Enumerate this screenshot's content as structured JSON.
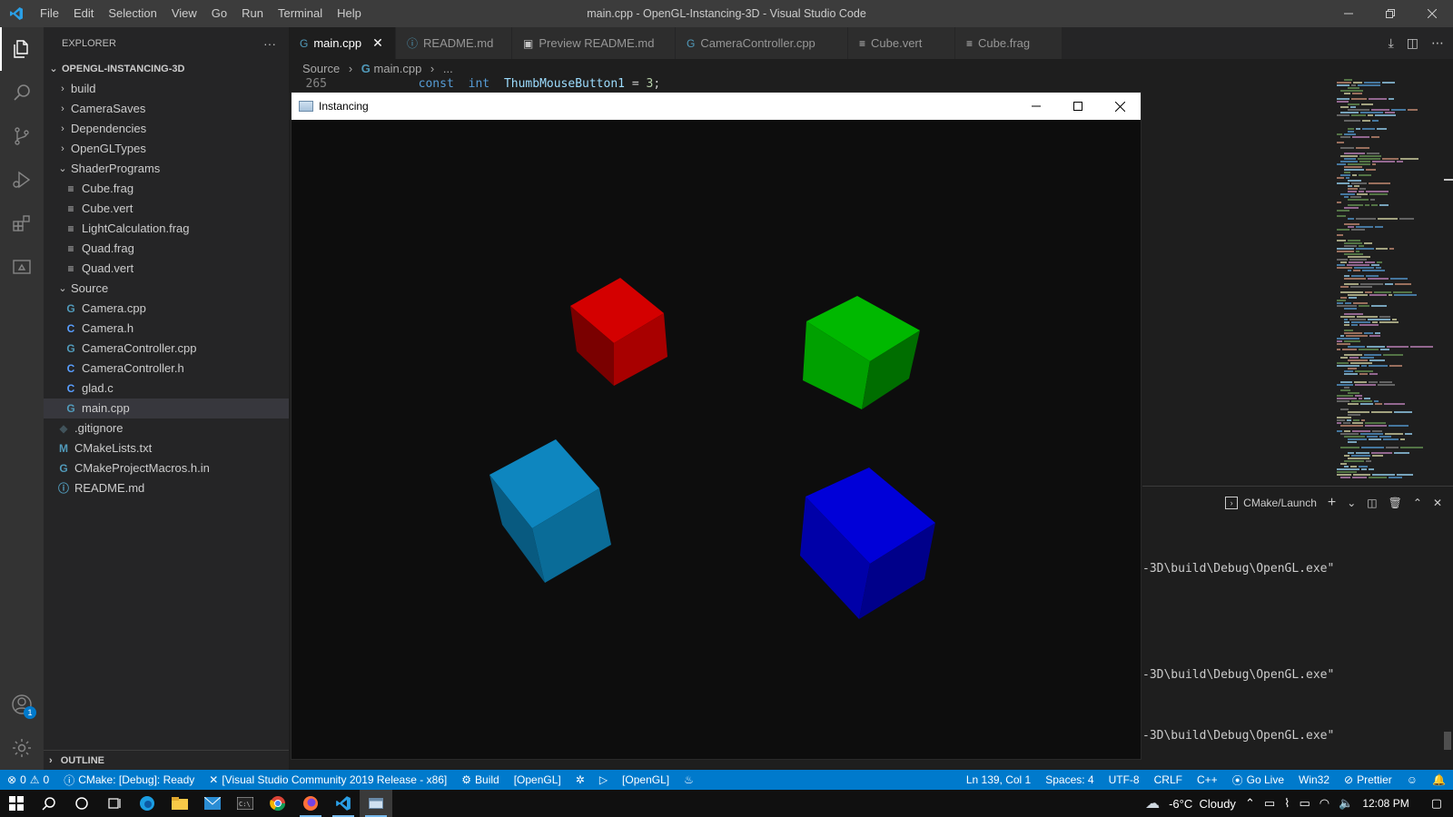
{
  "titlebar": {
    "menus": [
      "File",
      "Edit",
      "Selection",
      "View",
      "Go",
      "Run",
      "Terminal",
      "Help"
    ],
    "title": "main.cpp - OpenGL-Instancing-3D - Visual Studio Code"
  },
  "sidebar": {
    "header": "EXPLORER",
    "more": "···",
    "root": "OPENGL-INSTANCING-3D",
    "items": [
      {
        "label": "build",
        "type": "folder",
        "depth": 1,
        "expanded": false
      },
      {
        "label": "CameraSaves",
        "type": "folder",
        "depth": 1,
        "expanded": false
      },
      {
        "label": "Dependencies",
        "type": "folder",
        "depth": 1,
        "expanded": false
      },
      {
        "label": "OpenGLTypes",
        "type": "folder",
        "depth": 1,
        "expanded": false
      },
      {
        "label": "ShaderPrograms",
        "type": "folder",
        "depth": 1,
        "expanded": true
      },
      {
        "label": "Cube.frag",
        "type": "txt",
        "depth": 2
      },
      {
        "label": "Cube.vert",
        "type": "txt",
        "depth": 2
      },
      {
        "label": "LightCalculation.frag",
        "type": "txt",
        "depth": 2
      },
      {
        "label": "Quad.frag",
        "type": "txt",
        "depth": 2
      },
      {
        "label": "Quad.vert",
        "type": "txt",
        "depth": 2
      },
      {
        "label": "Source",
        "type": "folder",
        "depth": 1,
        "expanded": true
      },
      {
        "label": "Camera.cpp",
        "type": "cpp",
        "depth": 2
      },
      {
        "label": "Camera.h",
        "type": "c",
        "depth": 2
      },
      {
        "label": "CameraController.cpp",
        "type": "cpp",
        "depth": 2
      },
      {
        "label": "CameraController.h",
        "type": "c",
        "depth": 2
      },
      {
        "label": "glad.c",
        "type": "c",
        "depth": 2
      },
      {
        "label": "main.cpp",
        "type": "cpp",
        "depth": 2,
        "selected": true
      },
      {
        "label": ".gitignore",
        "type": "git",
        "depth": 1
      },
      {
        "label": "CMakeLists.txt",
        "type": "m",
        "depth": 1
      },
      {
        "label": "CMakeProjectMacros.h.in",
        "type": "cpp",
        "depth": 1
      },
      {
        "label": "README.md",
        "type": "info",
        "depth": 1
      }
    ],
    "outline": "OUTLINE"
  },
  "tabs": [
    {
      "label": "main.cpp",
      "icon": "cpp-icon",
      "active": true
    },
    {
      "label": "README.md",
      "icon": "info-icon",
      "active": false
    },
    {
      "label": "Preview README.md",
      "icon": "preview-icon",
      "active": false
    },
    {
      "label": "CameraController.cpp",
      "icon": "cpp-icon",
      "active": false
    },
    {
      "label": "Cube.vert",
      "icon": "lines-icon",
      "active": false
    },
    {
      "label": "Cube.frag",
      "icon": "lines-icon",
      "active": false
    }
  ],
  "breadcrumb": {
    "part1": "Source",
    "part2": "main.cpp",
    "part3": "..."
  },
  "code": {
    "line_number": "265",
    "kw1": "const",
    "kw2": "int",
    "ident": "ThumbMouseButton1",
    "eq": " = ",
    "value": "3",
    "semi": ";"
  },
  "terminal": {
    "dropdown_label": "CMake/Launch",
    "lines": [
      "-3D\\build\\Debug\\OpenGL.exe\"",
      "-3D\\build\\Debug\\OpenGL.exe\"",
      "-3D\\build\\Debug\\OpenGL.exe\""
    ]
  },
  "gl_window": {
    "title": "Instancing",
    "cube_colors": {
      "red": "#cc0000",
      "green": "#00b000",
      "cyan": "#0a7eb4",
      "blue": "#0000cc"
    }
  },
  "statusbar": {
    "errors": "0",
    "warnings": "0",
    "cmake_status": "CMake: [Debug]: Ready",
    "kit": "[Visual Studio Community 2019 Release - x86]",
    "build": "Build",
    "target1": "[OpenGL]",
    "target2": "[OpenGL]",
    "position": "Ln 139, Col 1",
    "spaces": "Spaces: 4",
    "encoding": "UTF-8",
    "eol": "CRLF",
    "language": "C++",
    "golive": "Go Live",
    "platform": "Win32",
    "prettier": "Prettier"
  },
  "taskbar": {
    "weather": "-6°C  Cloudy",
    "time": "12:08 PM"
  },
  "colors": {
    "accent": "#007acc",
    "titlebar": "#3c3c3c",
    "activitybar": "#333333",
    "sidebar": "#252526",
    "editor": "#1e1e1e"
  }
}
